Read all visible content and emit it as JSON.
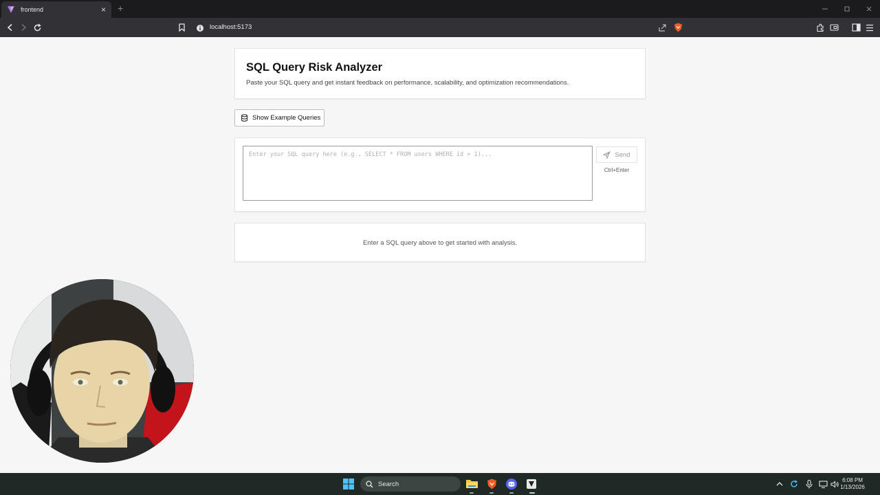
{
  "browser": {
    "tab_title": "frontend",
    "tab_close": "×",
    "new_tab": "+",
    "url": "localhost:5173",
    "icons": [
      "back-icon",
      "forward-icon",
      "reload-icon",
      "bookmark-icon",
      "site-info-icon",
      "share-icon",
      "brave-shields-icon",
      "extensions-icon",
      "wallet-icon",
      "sidebar-icon",
      "menu-icon"
    ]
  },
  "page": {
    "title": "SQL Query Risk Analyzer",
    "subtitle": "Paste your SQL query and get instant feedback on performance, scalability, and optimization recommendations.",
    "examples_button": "Show Example Queries",
    "query_placeholder": "Enter your SQL query here (e.g., SELECT * FROM users WHERE id = 1)...",
    "send_button": "Send",
    "shortcut_hint": "Ctrl+Enter",
    "empty_state": "Enter a SQL query above to get started with analysis."
  },
  "taskbar": {
    "search_label": "Search",
    "time": "6:08 PM",
    "date": "1/13/2026",
    "apps": [
      "windows-start-icon",
      "file-explorer-icon",
      "brave-icon",
      "discord-icon",
      "app-icon"
    ],
    "tray": [
      "chevron-up-icon",
      "sync-icon",
      "microphone-icon",
      "network-icon",
      "volume-icon"
    ]
  },
  "colors": {
    "page_background": "#f6f6f6",
    "browser_frame": "#1b1b1e",
    "toolbar": "#323236",
    "taskbar": "#1f2a26"
  }
}
